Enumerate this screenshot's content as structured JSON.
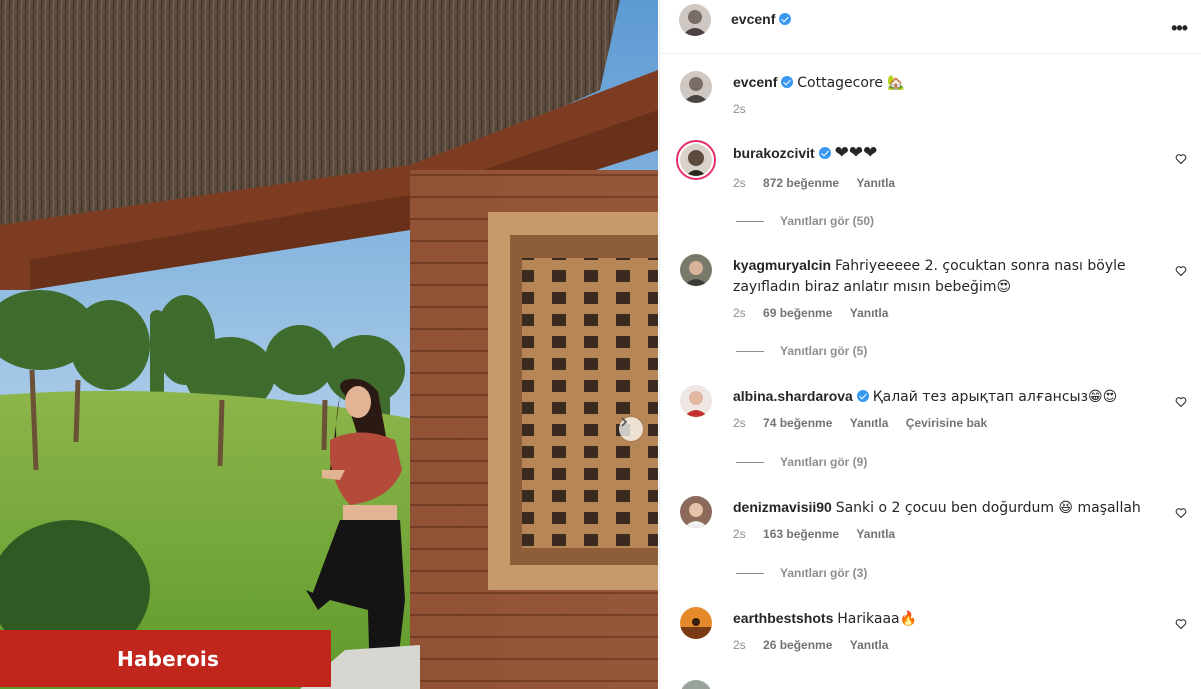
{
  "post": {
    "author": "evcenf",
    "more_icon": "more-horizontal-icon",
    "caption_text": "Cottagecore 🏡",
    "caption_time": "2s",
    "watermark": "Haberois"
  },
  "comments": [
    {
      "user": "burakozcivit",
      "verified": true,
      "text": "❤❤❤",
      "time": "2s",
      "likes": "872 beğenme",
      "reply": "Yanıtla",
      "translate": "",
      "replies": "Yanıtları gör (50)"
    },
    {
      "user": "kyagmuryalcin",
      "verified": false,
      "text": "Fahriyeeeee 2. çocuktan sonra nası böyle zayıfladın biraz anlatır mısın bebeğim😍",
      "time": "2s",
      "likes": "69 beğenme",
      "reply": "Yanıtla",
      "translate": "",
      "replies": "Yanıtları gör (5)"
    },
    {
      "user": "albina.shardarova",
      "verified": true,
      "text": "Қалай тез арықтап алғансыз😁😍",
      "time": "2s",
      "likes": "74 beğenme",
      "reply": "Yanıtla",
      "translate": "Çevirisine bak",
      "replies": "Yanıtları gör (9)"
    },
    {
      "user": "denizmavisii90",
      "verified": false,
      "text": "Sanki o 2 çocuu ben doğurdum 😆 maşallah",
      "time": "2s",
      "likes": "163 beğenme",
      "reply": "Yanıtla",
      "translate": "",
      "replies": "Yanıtları gör (3)"
    },
    {
      "user": "earthbestshots",
      "verified": false,
      "text": "Harikaaa🔥",
      "time": "2s",
      "likes": "26 beğenme",
      "reply": "Yanıtla",
      "translate": "",
      "replies": ""
    }
  ],
  "colors": {
    "verified": "#3897f0",
    "watermark_bg": "#c0261c",
    "muted_text": "#8e8e8e"
  }
}
